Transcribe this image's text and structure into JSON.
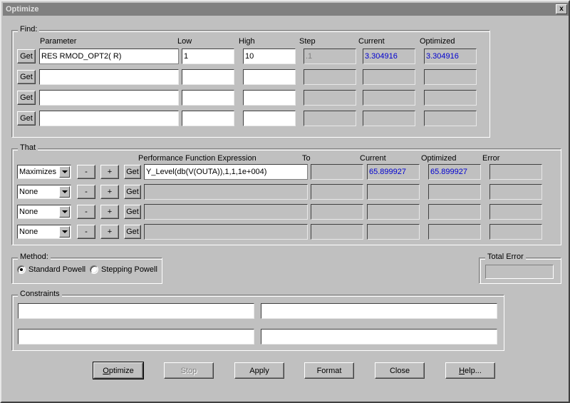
{
  "window": {
    "title": "Optimize",
    "close_icon": "close-icon",
    "close_label": "x"
  },
  "find": {
    "legend": "Find:",
    "columns": [
      "Parameter",
      "Low",
      "High",
      "Step",
      "Current",
      "Optimized"
    ],
    "get_label": "Get",
    "rows": [
      {
        "parameter": "RES RMOD_OPT2( R)",
        "low": "1",
        "high": "10",
        "step": ".1",
        "current": "3.304916",
        "optimized": "3.304916"
      },
      {
        "parameter": "",
        "low": "",
        "high": "",
        "step": "",
        "current": "",
        "optimized": ""
      },
      {
        "parameter": "",
        "low": "",
        "high": "",
        "step": "",
        "current": "",
        "optimized": ""
      },
      {
        "parameter": "",
        "low": "",
        "high": "",
        "step": "",
        "current": "",
        "optimized": ""
      }
    ]
  },
  "that": {
    "legend": "That",
    "columns": [
      "Performance Function Expression",
      "To",
      "Current",
      "Optimized",
      "Error"
    ],
    "get_label": "Get",
    "minus_label": "-",
    "plus_label": "+",
    "rows": [
      {
        "goal": "Maximizes",
        "expression": "Y_Level(db(V(OUTA)),1,1,1e+004)",
        "to": "",
        "current": "65.899927",
        "optimized": "65.899927",
        "error": ""
      },
      {
        "goal": "None",
        "expression": "",
        "to": "",
        "current": "",
        "optimized": "",
        "error": ""
      },
      {
        "goal": "None",
        "expression": "",
        "to": "",
        "current": "",
        "optimized": "",
        "error": ""
      },
      {
        "goal": "None",
        "expression": "",
        "to": "",
        "current": "",
        "optimized": "",
        "error": ""
      }
    ]
  },
  "method": {
    "legend": "Method:",
    "options": [
      {
        "label": "Standard Powell",
        "selected": true
      },
      {
        "label": "Stepping Powell",
        "selected": false
      }
    ]
  },
  "total_error": {
    "legend": "Total Error",
    "value": ""
  },
  "constraints": {
    "legend": "Constraints",
    "values": [
      "",
      "",
      "",
      ""
    ]
  },
  "buttons": {
    "optimize": {
      "pre": "",
      "acc": "O",
      "post": "ptimize"
    },
    "stop": "Stop",
    "apply": "Apply",
    "format": "Format",
    "close": "Close",
    "help": {
      "pre": "",
      "acc": "H",
      "post": "elp..."
    }
  },
  "colors": {
    "face": "#c0c0c0",
    "titlebar": "#808080",
    "value_blue": "#0000d0",
    "disabled_text": "#808080"
  }
}
